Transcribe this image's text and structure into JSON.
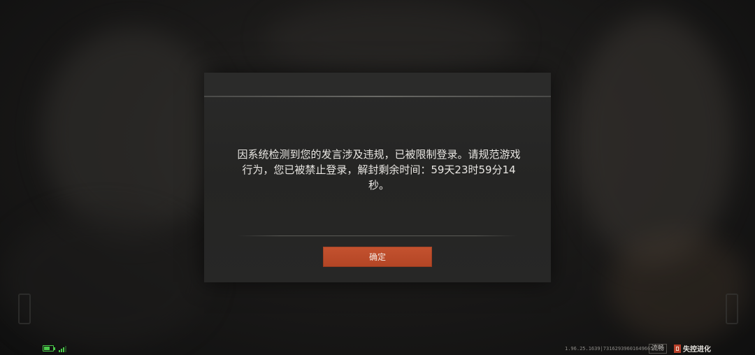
{
  "dialog": {
    "message": "因系统检测到您的发言涉及违规，已被限制登录。请规范游戏行为，您已被禁止登录，解封剩余时间：59天23时59分14秒。",
    "confirm_label": "确定"
  },
  "status_bar": {
    "battery_level": 0.7,
    "signal_bars": 3,
    "version": "1.96.25.1639|73162939601649665",
    "quality_label": "流畅",
    "brand_name": "失控进化"
  },
  "colors": {
    "accent_button": "#c4522f",
    "battery_green": "#4ac94a",
    "dialog_bg": "#272726"
  }
}
